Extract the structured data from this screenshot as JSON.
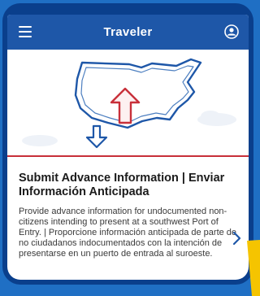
{
  "header": {
    "title": "Traveler"
  },
  "card": {
    "title": "Submit Advance Information | Enviar Información Anticipada",
    "description": "Provide advance information for undocumented non-citizens intending to present at a southwest Port of Entry. | Proporcione información anticipada de parte de no ciudadanos indocumentados con la intención de presentarse en un puerto de entrada al suroeste."
  },
  "icons": {
    "menu": "hamburger-menu-icon",
    "profile": "user-profile-icon",
    "chevron": "chevron-right-icon",
    "illustration": "us-map-arrows-illustration"
  },
  "colors": {
    "background": "#1f6fc4",
    "device_frame": "#0a3f8c",
    "app_bar": "#1e57a8",
    "map_outline": "#1e57a8",
    "accent_red": "#c8303a",
    "highlight_yellow": "#f5c400"
  }
}
